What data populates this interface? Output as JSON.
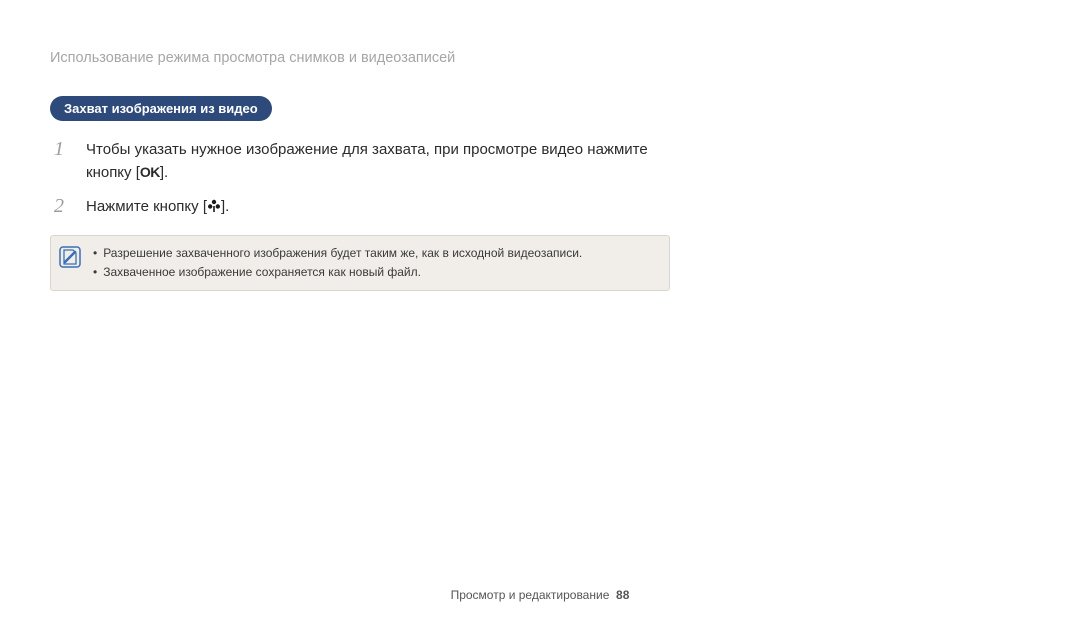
{
  "header": {
    "title": "Использование режима просмотра снимков и видеозаписей"
  },
  "section": {
    "pill": "Захват изображения из видео"
  },
  "steps": [
    {
      "num": "1",
      "pre": "Чтобы указать нужное изображение для захвата, при просмотре видео нажмите кнопку [",
      "post": "]."
    },
    {
      "num": "2",
      "pre": "Нажмите кнопку [",
      "post": "]."
    }
  ],
  "notes": [
    "Разрешение захваченного изображения будет таким же, как в исходной видеозаписи.",
    "Захваченное изображение сохраняется как новый файл."
  ],
  "footer": {
    "section": "Просмотр и редактирование",
    "page": "88"
  },
  "glyphs": {
    "ok": "OK"
  }
}
